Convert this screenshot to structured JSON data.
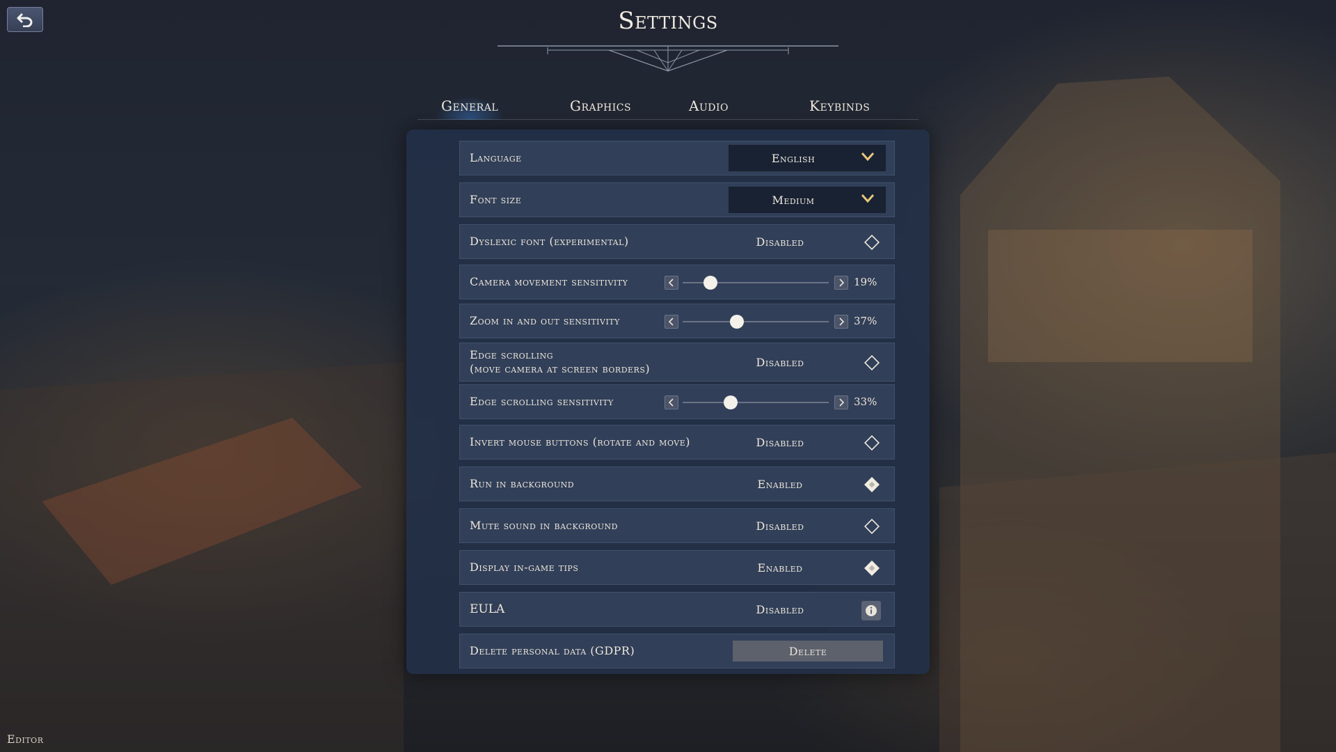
{
  "header": {
    "title": "Settings"
  },
  "tabs": [
    {
      "label": "General",
      "active": true
    },
    {
      "label": "Graphics",
      "active": false
    },
    {
      "label": "Audio",
      "active": false
    },
    {
      "label": "Keybinds",
      "active": false
    }
  ],
  "settings": {
    "language": {
      "label": "Language",
      "value": "English"
    },
    "font_size": {
      "label": "Font size",
      "value": "Medium"
    },
    "dyslexic_font": {
      "label": "Dyslexic font (experimental)",
      "state": "Disabled",
      "enabled": false
    },
    "camera_sensitivity": {
      "label": "Camera movement sensitivity",
      "value_text": "19%",
      "value": 19
    },
    "zoom_sensitivity": {
      "label": "Zoom in and out sensitivity",
      "value_text": "37%",
      "value": 37
    },
    "edge_scrolling": {
      "label_line1": "Edge scrolling",
      "label_line2": "(move camera at screen borders)",
      "state": "Disabled",
      "enabled": false
    },
    "edge_scrolling_sensitivity": {
      "label": "Edge scrolling sensitivity",
      "value_text": "33%",
      "value": 33
    },
    "invert_mouse": {
      "label": "Invert mouse buttons (rotate and move)",
      "state": "Disabled",
      "enabled": false
    },
    "run_background": {
      "label": "Run in background",
      "state": "Enabled",
      "enabled": true
    },
    "mute_background": {
      "label": "Mute sound in background",
      "state": "Disabled",
      "enabled": false
    },
    "ingame_tips": {
      "label": "Display in-game tips",
      "state": "Enabled",
      "enabled": true
    },
    "eula": {
      "label": "EULA",
      "state": "Disabled"
    },
    "gdpr": {
      "label": "Delete personal data (GDPR)",
      "button_label": "Delete"
    }
  },
  "footer": {
    "editor_label": "Editor"
  },
  "colors": {
    "panel": "#22304a",
    "row": "#34425c",
    "chevron": "#e8c77a",
    "accent_tab": "#3c78c8"
  }
}
